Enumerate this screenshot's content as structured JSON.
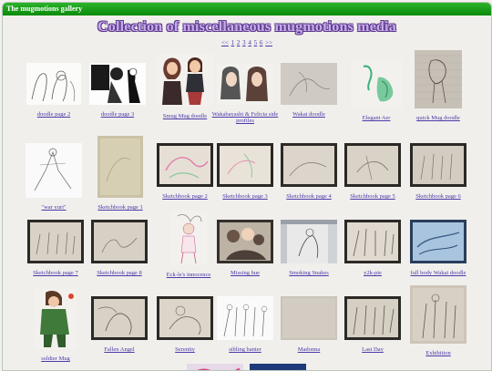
{
  "window": {
    "title": "The mugmotions gallery"
  },
  "heading": "Collection of miscellaneous mugmotions media",
  "pager": [
    "<<",
    "1",
    "2",
    "3",
    "4",
    "5",
    "6",
    ">>"
  ],
  "items": [
    {
      "label": "doodle page 2"
    },
    {
      "label": "doodle page 3"
    },
    {
      "label": "Smug Mug doodle"
    },
    {
      "label": "Wakabayashi & Felicia side profiles"
    },
    {
      "label": "Wakai doodle"
    },
    {
      "label": "Elegant Aer"
    },
    {
      "label": "quick Mug doodle"
    },
    {
      "label": "\"war yuri\""
    },
    {
      "label": "Sketchbook page 1"
    },
    {
      "label": "Sketchbook page 2"
    },
    {
      "label": "Sketchbook page 3"
    },
    {
      "label": "Sketchbook page 4"
    },
    {
      "label": "Sketchbook page 5"
    },
    {
      "label": "Sketchbook page 6"
    },
    {
      "label": "Sketchbook page 7"
    },
    {
      "label": "Sketchbook page 8"
    },
    {
      "label": "Eck-le's innocence"
    },
    {
      "label": "Missing hue"
    },
    {
      "label": "Smoking Snakes"
    },
    {
      "label": "y2k-pie"
    },
    {
      "label": "full body Wakai doodle"
    },
    {
      "label": "soldier Mug"
    },
    {
      "label": "Fallen Angel"
    },
    {
      "label": "Serenity"
    },
    {
      "label": "sibling banter"
    },
    {
      "label": "Madonna"
    },
    {
      "label": "Last Day"
    },
    {
      "label": "Exhibition"
    }
  ]
}
